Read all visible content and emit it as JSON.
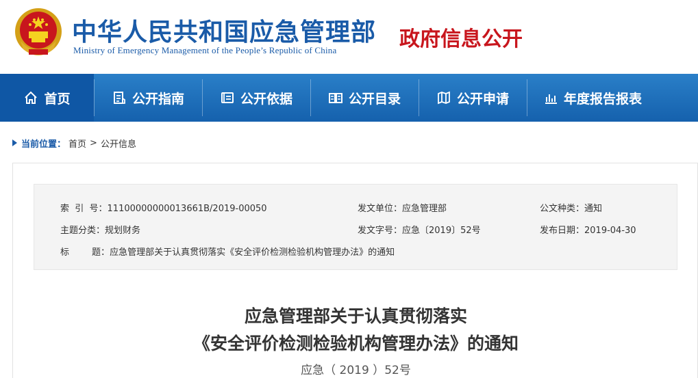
{
  "header": {
    "site_title": "中华人民共和国应急管理部",
    "site_subtitle": "Ministry of Emergency Management of the People’s Republic of China",
    "section_badge": "政府信息公开",
    "colors": {
      "brand_blue": "#1a5ba8",
      "badge_red": "#c8161d"
    }
  },
  "nav": {
    "items": [
      {
        "label": "首页",
        "icon": "home-icon"
      },
      {
        "label": "公开指南",
        "icon": "document-list-icon"
      },
      {
        "label": "公开依据",
        "icon": "book-icon"
      },
      {
        "label": "公开目录",
        "icon": "open-book-icon"
      },
      {
        "label": "公开申请",
        "icon": "map-icon"
      },
      {
        "label": "年度报告报表",
        "icon": "bar-chart-icon"
      }
    ]
  },
  "breadcrumb": {
    "label": "当前位置：",
    "items": [
      "首页",
      "公开信息"
    ],
    "separator": ">"
  },
  "meta": {
    "index_no": {
      "label": "索  引  号：",
      "value": "11100000000013661B/2019-00050"
    },
    "issuer": {
      "label": "发文单位：",
      "value": "应急管理部"
    },
    "doc_type": {
      "label": "公文种类：",
      "value": "通知"
    },
    "category": {
      "label": "主题分类：",
      "value": "规划财务"
    },
    "doc_no": {
      "label": "发文字号：",
      "value": "应急〔2019〕52号"
    },
    "date": {
      "label": "发布日期：",
      "value": "2019-04-30"
    },
    "title": {
      "label": "标        题：",
      "value": "应急管理部关于认真贯彻落实《安全评价检测检验机构管理办法》的通知"
    }
  },
  "document": {
    "title_line1": "应急管理部关于认真贯彻落实",
    "title_line2": "《安全评价检测检验机构管理办法》的通知",
    "number": "应急（ 2019 ）52号"
  }
}
